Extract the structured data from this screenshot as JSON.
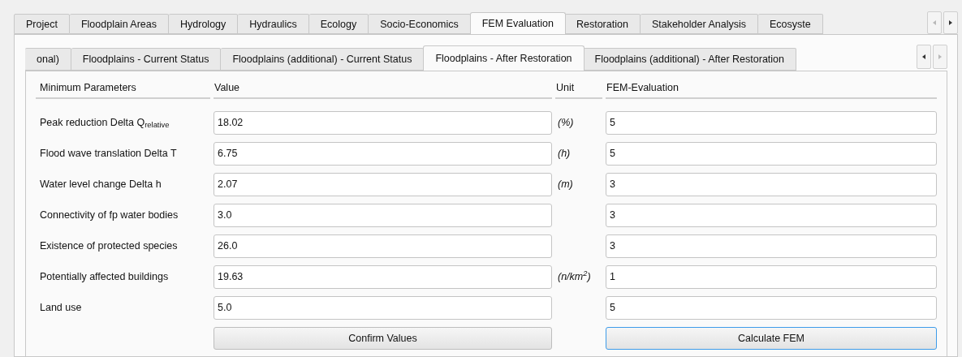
{
  "outer_tabs": [
    {
      "label": "Project",
      "selected": false
    },
    {
      "label": "Floodplain Areas",
      "selected": false
    },
    {
      "label": "Hydrology",
      "selected": false
    },
    {
      "label": "Hydraulics",
      "selected": false
    },
    {
      "label": "Ecology",
      "selected": false
    },
    {
      "label": "Socio-Economics",
      "selected": false
    },
    {
      "label": "FEM Evaluation",
      "selected": true
    },
    {
      "label": "Restoration",
      "selected": false
    },
    {
      "label": "Stakeholder Analysis",
      "selected": false
    },
    {
      "label": "Ecosyste",
      "selected": false
    }
  ],
  "outer_scroll": {
    "left_disabled": true,
    "right_disabled": false
  },
  "inner_tabs": [
    {
      "label": "onal)",
      "selected": false
    },
    {
      "label": "Floodplains - Current Status",
      "selected": false
    },
    {
      "label": "Floodplains (additional) - Current Status",
      "selected": false
    },
    {
      "label": "Floodplains - After Restoration",
      "selected": true
    },
    {
      "label": "Floodplains (additional) - After Restoration",
      "selected": false
    }
  ],
  "inner_scroll": {
    "left_disabled": false,
    "right_disabled": true
  },
  "columns": [
    "Minimum Parameters",
    "Value",
    "Unit",
    "FEM-Evaluation"
  ],
  "rows": [
    {
      "label": "Peak reduction Delta Q$_{relative}$",
      "value": "18.02",
      "unit": "(%)",
      "fem": "5"
    },
    {
      "label": "Flood wave translation Delta T",
      "value": "6.75",
      "unit": "(h)",
      "fem": "5"
    },
    {
      "label": "Water level change Delta h",
      "value": "2.07",
      "unit": "(m)",
      "fem": "3"
    },
    {
      "label": "Connectivity of fp water bodies",
      "value": "3.0",
      "fem": "3"
    },
    {
      "label": "Existence of protected species",
      "value": "26.0",
      "fem": "3"
    },
    {
      "label": "Potentially affected buildings",
      "value": "19.63",
      "unit": "(n/km$^{2}$)",
      "fem": "1"
    },
    {
      "label": "Land use",
      "value": "5.0",
      "fem": "5"
    }
  ],
  "buttons": [
    {
      "label": "Confirm Values",
      "focused": false
    },
    {
      "label": "Calculate FEM",
      "focused": true
    }
  ]
}
